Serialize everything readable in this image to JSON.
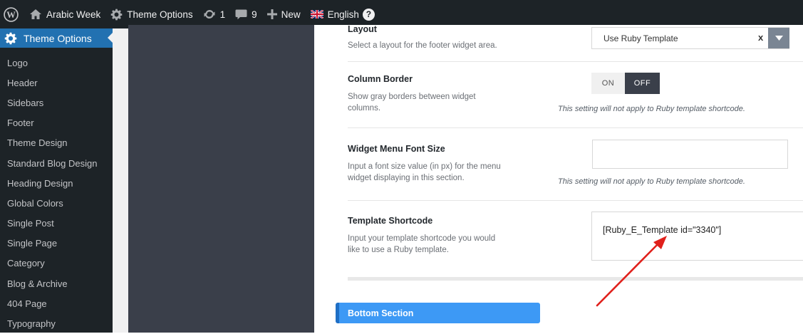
{
  "adminbar": {
    "site_name": "Arabic Week",
    "theme_options": "Theme Options",
    "updates_count": "1",
    "comments_count": "9",
    "new_label": "New",
    "language": "English",
    "help": "?"
  },
  "sidemenu": {
    "current": "Theme Options",
    "items": [
      "Logo",
      "Header",
      "Sidebars",
      "Footer",
      "Theme Design",
      "Standard Blog Design",
      "Heading Design",
      "Global Colors",
      "Single Post",
      "Single Page",
      "Category",
      "Blog & Archive",
      "404 Page",
      "Typography"
    ]
  },
  "fields": {
    "layout": {
      "title": "Layout",
      "desc": "Select a layout for the footer widget area.",
      "value": "Use Ruby Template",
      "clear": "x"
    },
    "column_border": {
      "title": "Column Border",
      "desc": "Show gray borders between widget columns.",
      "on_label": "ON",
      "off_label": "OFF",
      "note": "This setting will not apply to Ruby template shortcode."
    },
    "widget_menu_font_size": {
      "title": "Widget Menu Font Size",
      "desc": "Input a font size value (in px) for the menu widget displaying in this section.",
      "value": "",
      "note": "This setting will not apply to Ruby template shortcode."
    },
    "template_shortcode": {
      "title": "Template Shortcode",
      "desc": "Input your template shortcode you would like to use a Ruby template.",
      "value": "[Ruby_E_Template id=\"3340\"]"
    }
  },
  "section": {
    "bottom_title": "Bottom Section"
  },
  "colors": {
    "adminbar_bg": "#1d2327",
    "menu_active": "#2271b1",
    "redux_sidebar": "#3a3f4a",
    "section_header": "#3d99f5",
    "annotation_arrow": "#e0201b"
  }
}
